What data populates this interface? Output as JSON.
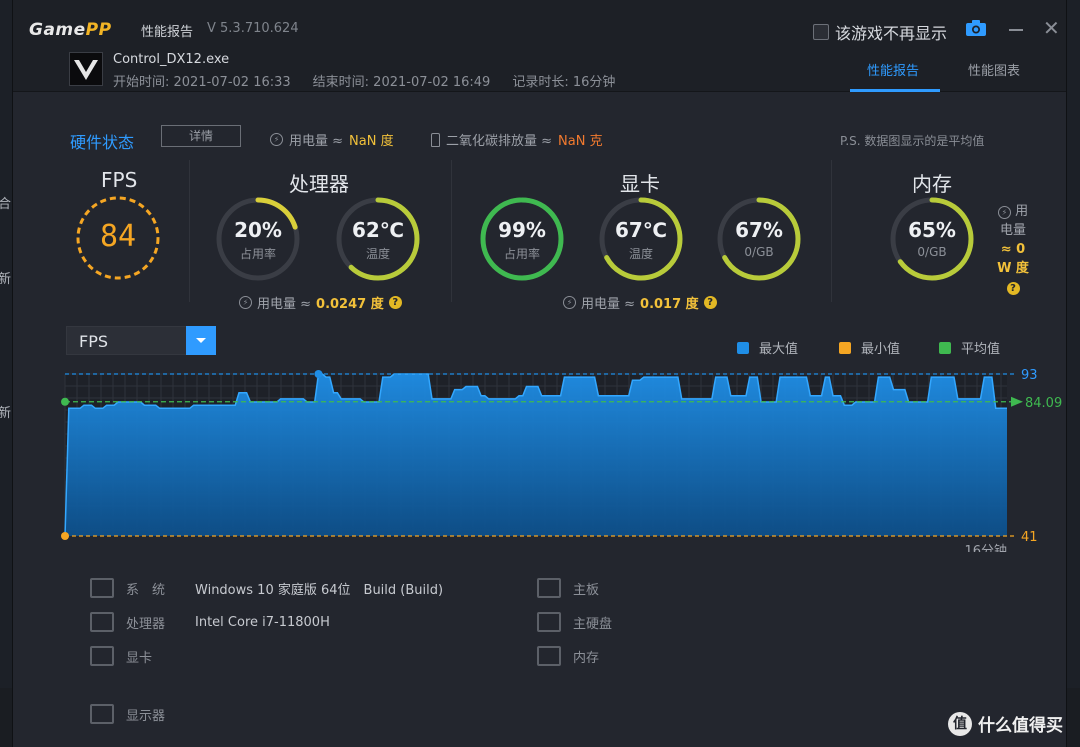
{
  "title_bar": {
    "logo_game": "Game",
    "logo_pp": "PP",
    "title": "性能报告",
    "version": "V 5.3.710.624",
    "dont_show_label": "该游戏不再显示"
  },
  "session": {
    "exe": "Control_DX12.exe",
    "start": "开始时间: 2021-07-02 16:33",
    "end": "结束时间: 2021-07-02 16:49",
    "duration": "记录时长: 16分钟"
  },
  "tabs": [
    {
      "label": "性能报告",
      "active": true
    },
    {
      "label": "性能图表",
      "active": false
    }
  ],
  "hardware": {
    "title": "硬件状态",
    "detail_button": "详情",
    "power_label": "用电量 ≈",
    "power_value": "NaN 度",
    "co2_label": "二氧化碳排放量 ≈",
    "co2_value": "NaN 克",
    "note": "P.S. 数据图显示的是平均值"
  },
  "fps_panel": {
    "title": "FPS",
    "value": "84"
  },
  "cpu_panel": {
    "title": "处理器",
    "usage": {
      "value": "20%",
      "label": "占用率",
      "fraction": 0.2
    },
    "temp": {
      "value": "62℃",
      "label": "温度",
      "fraction": 0.62
    },
    "power_label": "用电量 ≈",
    "power_value": "0.0247 度"
  },
  "gpu_panel": {
    "title": "显卡",
    "usage": {
      "value": "99%",
      "label": "占用率",
      "fraction": 0.99
    },
    "temp": {
      "value": "67℃",
      "label": "温度",
      "fraction": 0.67
    },
    "vram": {
      "value": "67%",
      "label": "0/GB",
      "fraction": 0.67
    },
    "power_label": "用电量 ≈",
    "power_value": "0.017 度"
  },
  "mem_panel": {
    "title": "内存",
    "usage": {
      "value": "65%",
      "label": "0/GB",
      "fraction": 0.65
    },
    "power_line1": "用",
    "power_line2": "电量",
    "power_line3": "≈ 0",
    "power_line4": "W 度"
  },
  "chart_panel": {
    "selector": "FPS",
    "legend": [
      {
        "label": "最大值",
        "color": "#1f8ee6"
      },
      {
        "label": "最小值",
        "color": "#f5a623"
      },
      {
        "label": "平均值",
        "color": "#3fb950"
      }
    ],
    "max_label": "93",
    "avg_label": "84.09",
    "min_label": "41",
    "x_end_label": "16分钟"
  },
  "chart_data": {
    "type": "area",
    "series": [
      {
        "values": [
          41,
          82,
          82,
          82,
          82,
          83,
          83,
          83,
          82,
          82,
          82,
          83,
          83,
          83,
          84,
          84,
          84,
          84,
          84,
          84,
          84,
          83,
          83,
          83,
          83,
          82,
          82,
          82,
          82,
          82,
          82,
          82,
          82,
          82,
          83,
          83,
          83,
          83,
          83,
          83,
          83,
          83,
          83,
          83,
          83,
          83,
          87,
          87,
          87,
          84,
          84,
          84,
          84,
          84,
          84,
          84,
          84,
          85,
          85,
          85,
          85,
          85,
          85,
          85,
          84,
          84,
          84,
          93,
          93,
          92,
          92,
          87,
          87,
          85,
          85,
          85,
          85,
          85,
          85,
          84,
          84,
          84,
          84,
          84,
          92,
          92,
          92,
          93,
          93,
          93,
          93,
          93,
          93,
          93,
          93,
          93,
          93,
          85,
          85,
          85,
          85,
          85,
          85,
          88,
          88,
          88,
          89,
          89,
          89,
          89,
          86,
          86,
          85,
          85,
          85,
          85,
          85,
          85,
          85,
          85,
          86,
          86,
          89,
          89,
          89,
          89,
          86,
          86,
          86,
          86,
          86,
          86,
          92,
          92,
          92,
          92,
          92,
          92,
          92,
          92,
          92,
          86,
          86,
          86,
          86,
          86,
          86,
          86,
          86,
          86,
          91,
          91,
          91,
          92,
          92,
          92,
          92,
          92,
          92,
          92,
          92,
          92,
          92,
          85,
          85,
          85,
          85,
          85,
          85,
          85,
          85,
          85,
          92,
          92,
          92,
          92,
          86,
          86,
          86,
          86,
          86,
          92,
          92,
          92,
          84,
          84,
          84,
          84,
          84,
          92,
          92,
          92,
          92,
          92,
          92,
          92,
          92,
          86,
          86,
          86,
          86,
          92,
          92,
          86,
          86,
          86,
          83,
          83,
          83,
          84,
          84,
          84,
          84,
          84,
          84,
          92,
          92,
          92,
          92,
          88,
          88,
          88,
          88,
          84,
          84,
          84,
          84,
          84,
          84,
          92,
          92,
          92,
          92,
          92,
          92,
          92,
          85,
          85,
          85,
          85,
          85,
          85,
          85,
          92,
          92,
          92,
          82,
          82,
          82,
          82
        ],
        "color": "#1f8ee6"
      }
    ],
    "max": 93,
    "min": 41,
    "avg": 84.09,
    "ylim": [
      41,
      93
    ],
    "x_end_label": "16分钟"
  },
  "system_info": {
    "os_label": "系　统",
    "os_value": "Windows 10 家庭版 64位　Build (Build)",
    "cpu_label": "处理器",
    "cpu_value": "Intel Core i7-11800H",
    "gpu_label": "显卡",
    "display_label": "显示器",
    "board_label": "主板",
    "disk_label": "主硬盘",
    "ram_label": "内存"
  },
  "background_fragments": {
    "f1": "合",
    "f2": "新",
    "f3": "新"
  },
  "watermark": {
    "symbol": "值",
    "text": "什么值得买"
  }
}
